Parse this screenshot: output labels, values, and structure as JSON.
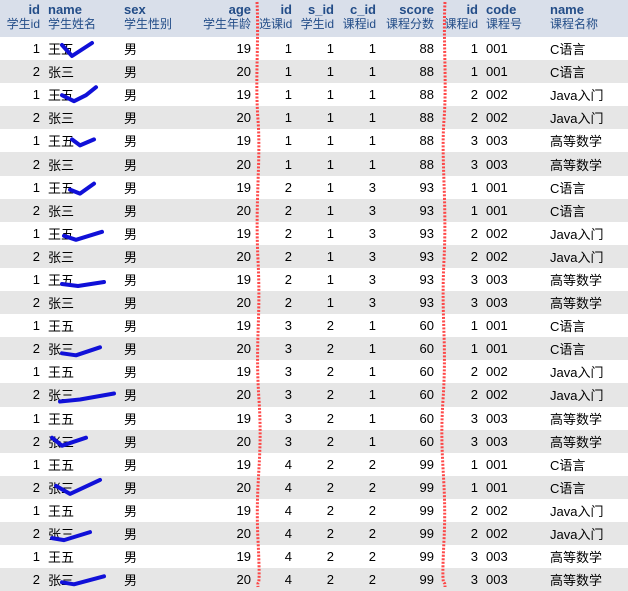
{
  "columns": [
    {
      "name": "id",
      "comment": "学生id",
      "align": "r"
    },
    {
      "name": "name",
      "comment": "学生姓名",
      "align": "l"
    },
    {
      "name": "sex",
      "comment": "学生性别",
      "align": "l"
    },
    {
      "name": "age",
      "comment": "学生年龄",
      "align": "r"
    },
    {
      "name": "id",
      "comment": "选课id",
      "align": "r"
    },
    {
      "name": "s_id",
      "comment": "学生id",
      "align": "r"
    },
    {
      "name": "c_id",
      "comment": "课程id",
      "align": "r"
    },
    {
      "name": "score",
      "comment": "课程分数",
      "align": "r"
    },
    {
      "name": "id",
      "comment": "课程id",
      "align": "r"
    },
    {
      "name": "code",
      "comment": "课程号",
      "align": "l"
    },
    {
      "name": "name",
      "comment": "课程名称",
      "align": "l"
    }
  ],
  "rows": [
    [
      "1",
      "王五",
      "男",
      "19",
      "1",
      "1",
      "1",
      "88",
      "1",
      "001",
      "C语言"
    ],
    [
      "2",
      "张三",
      "男",
      "20",
      "1",
      "1",
      "1",
      "88",
      "1",
      "001",
      "C语言"
    ],
    [
      "1",
      "王五",
      "男",
      "19",
      "1",
      "1",
      "1",
      "88",
      "2",
      "002",
      "Java入门"
    ],
    [
      "2",
      "张三",
      "男",
      "20",
      "1",
      "1",
      "1",
      "88",
      "2",
      "002",
      "Java入门"
    ],
    [
      "1",
      "王五",
      "男",
      "19",
      "1",
      "1",
      "1",
      "88",
      "3",
      "003",
      "高等数学"
    ],
    [
      "2",
      "张三",
      "男",
      "20",
      "1",
      "1",
      "1",
      "88",
      "3",
      "003",
      "高等数学"
    ],
    [
      "1",
      "王五",
      "男",
      "19",
      "2",
      "1",
      "3",
      "93",
      "1",
      "001",
      "C语言"
    ],
    [
      "2",
      "张三",
      "男",
      "20",
      "2",
      "1",
      "3",
      "93",
      "1",
      "001",
      "C语言"
    ],
    [
      "1",
      "王五",
      "男",
      "19",
      "2",
      "1",
      "3",
      "93",
      "2",
      "002",
      "Java入门"
    ],
    [
      "2",
      "张三",
      "男",
      "20",
      "2",
      "1",
      "3",
      "93",
      "2",
      "002",
      "Java入门"
    ],
    [
      "1",
      "王五",
      "男",
      "19",
      "2",
      "1",
      "3",
      "93",
      "3",
      "003",
      "高等数学"
    ],
    [
      "2",
      "张三",
      "男",
      "20",
      "2",
      "1",
      "3",
      "93",
      "3",
      "003",
      "高等数学"
    ],
    [
      "1",
      "王五",
      "男",
      "19",
      "3",
      "2",
      "1",
      "60",
      "1",
      "001",
      "C语言"
    ],
    [
      "2",
      "张三",
      "男",
      "20",
      "3",
      "2",
      "1",
      "60",
      "1",
      "001",
      "C语言"
    ],
    [
      "1",
      "王五",
      "男",
      "19",
      "3",
      "2",
      "1",
      "60",
      "2",
      "002",
      "Java入门"
    ],
    [
      "2",
      "张三",
      "男",
      "20",
      "3",
      "2",
      "1",
      "60",
      "2",
      "002",
      "Java入门"
    ],
    [
      "1",
      "王五",
      "男",
      "19",
      "3",
      "2",
      "1",
      "60",
      "3",
      "003",
      "高等数学"
    ],
    [
      "2",
      "张三",
      "男",
      "20",
      "3",
      "2",
      "1",
      "60",
      "3",
      "003",
      "高等数学"
    ],
    [
      "1",
      "王五",
      "男",
      "19",
      "4",
      "2",
      "2",
      "99",
      "1",
      "001",
      "C语言"
    ],
    [
      "2",
      "张三",
      "男",
      "20",
      "4",
      "2",
      "2",
      "99",
      "1",
      "001",
      "C语言"
    ],
    [
      "1",
      "王五",
      "男",
      "19",
      "4",
      "2",
      "2",
      "99",
      "2",
      "002",
      "Java入门"
    ],
    [
      "2",
      "张三",
      "男",
      "20",
      "4",
      "2",
      "2",
      "99",
      "2",
      "002",
      "Java入门"
    ],
    [
      "1",
      "王五",
      "男",
      "19",
      "4",
      "2",
      "2",
      "99",
      "3",
      "003",
      "高等数学"
    ],
    [
      "2",
      "张三",
      "男",
      "20",
      "4",
      "2",
      "2",
      "99",
      "3",
      "003",
      "高等数学"
    ]
  ],
  "colors": {
    "header_bg": "#d9dfea",
    "header_text": "#234d88",
    "row_alt_bg": "#e6e6e6",
    "annotation_red": "#ff2a2a",
    "annotation_blue": "#1010d8"
  }
}
